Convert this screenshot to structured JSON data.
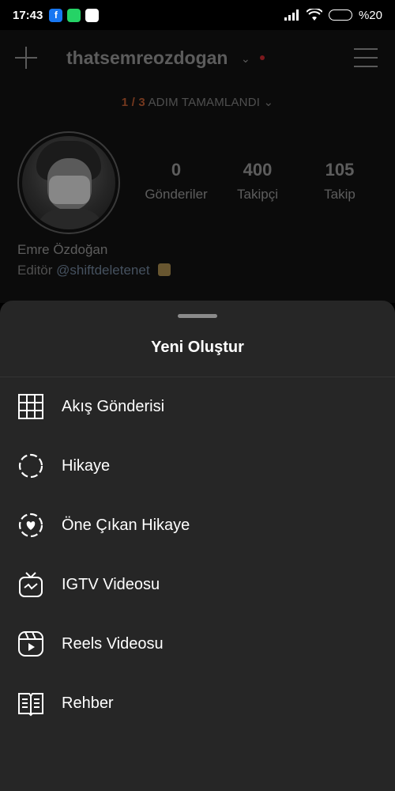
{
  "status_bar": {
    "time": "17:43",
    "battery": "%20"
  },
  "profile": {
    "username": "thatsemreozdogan",
    "steps": {
      "done": "1 / 3",
      "label": "ADIM TAMAMLANDI"
    },
    "stats": [
      {
        "value": "0",
        "label": "Gönderiler"
      },
      {
        "value": "400",
        "label": "Takipçi"
      },
      {
        "value": "105",
        "label": "Takip"
      }
    ],
    "name": "Emre Özdoğan",
    "bio_prefix": "Editör",
    "bio_handle": "@shiftdeletenet"
  },
  "sheet": {
    "title": "Yeni Oluştur",
    "options": [
      {
        "label": "Akış Gönderisi",
        "icon": "grid-icon"
      },
      {
        "label": "Hikaye",
        "icon": "story-icon"
      },
      {
        "label": "Öne Çıkan Hikaye",
        "icon": "highlight-icon"
      },
      {
        "label": "IGTV Videosu",
        "icon": "igtv-icon"
      },
      {
        "label": "Reels Videosu",
        "icon": "reels-icon"
      },
      {
        "label": "Rehber",
        "icon": "guide-icon"
      }
    ]
  },
  "colors": {
    "sheet_bg": "#262626",
    "steps_accent": "#b3562e",
    "dot": "#c0272d"
  }
}
